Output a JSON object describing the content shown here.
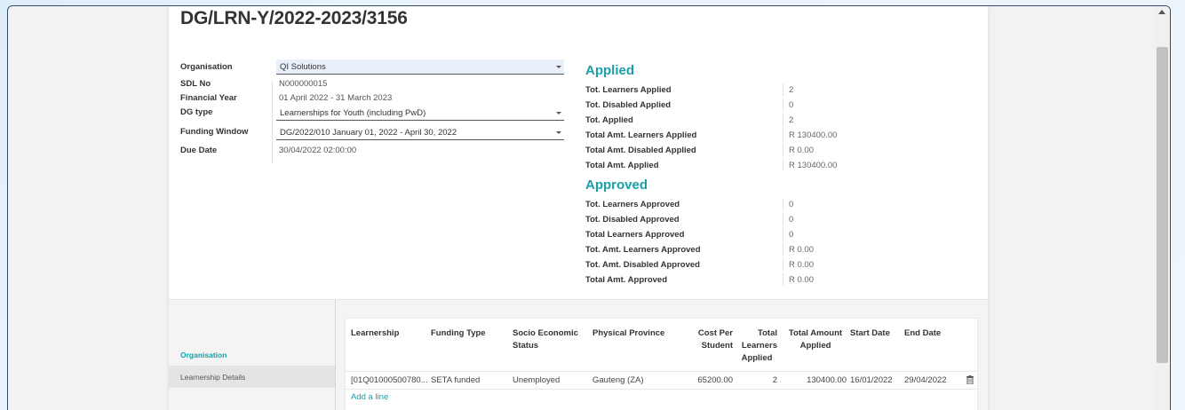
{
  "document": {
    "title": "DG/LRN-Y/2022-2023/3156"
  },
  "form": {
    "organisation": {
      "label": "Organisation",
      "value": "QI Solutions"
    },
    "sdl_no": {
      "label": "SDL No",
      "value": "N000000015"
    },
    "financial_year": {
      "label": "Financial Year",
      "value": "01 April 2022 - 31 March 2023"
    },
    "dg_type": {
      "label": "DG type",
      "value": "Learnerships for Youth (including PwD)"
    },
    "funding_window": {
      "label": "Funding Window",
      "value": "DG/2022/010 January 01, 2022 - April 30, 2022"
    },
    "due_date": {
      "label": "Due Date",
      "value": "30/04/2022 02:00:00"
    }
  },
  "applied": {
    "heading": "Applied",
    "rows": [
      {
        "label": "Tot. Learners Applied",
        "value": "2"
      },
      {
        "label": "Tot. Disabled Applied",
        "value": "0"
      },
      {
        "label": "Tot. Applied",
        "value": "2"
      },
      {
        "label": "Total Amt. Learners Applied",
        "value": "R 130400.00"
      },
      {
        "label": "Total Amt. Disabled Applied",
        "value": "R 0.00"
      },
      {
        "label": "Total Amt. Applied",
        "value": "R 130400.00"
      }
    ]
  },
  "approved": {
    "heading": "Approved",
    "rows": [
      {
        "label": "Tot. Learners Approved",
        "value": "0"
      },
      {
        "label": "Tot. Disabled Approved",
        "value": "0"
      },
      {
        "label": "Total Learners Approved",
        "value": "0"
      },
      {
        "label": "Tot. Amt. Learners Approved",
        "value": "R 0.00"
      },
      {
        "label": "Tot. Amt. Disabled Approved",
        "value": "R 0.00"
      },
      {
        "label": "Total Amt. Approved",
        "value": "R 0.00"
      }
    ]
  },
  "tabs": [
    {
      "label": "Organisation"
    },
    {
      "label": "Learnership Details"
    }
  ],
  "table": {
    "columns": {
      "learnership": "Learnership",
      "funding_type": "Funding Type",
      "socio_line1": "Socio Economic",
      "socio_line2": "Status",
      "province": "Physical Province",
      "cost_line1": "Cost Per",
      "cost_line2": "Student",
      "total_line1": "Total",
      "total_line2": "Learners",
      "total_line3": "Applied",
      "amount_line1": "Total Amount",
      "amount_line2": "Applied",
      "start_date": "Start Date",
      "end_date": "End Date"
    },
    "rows": [
      {
        "learnership": "[01Q01000500780...",
        "funding_type": "SETA funded",
        "socio": "Unemployed",
        "province": "Gauteng (ZA)",
        "cost": "65200.00",
        "learners": "2",
        "amount": "130400.00",
        "start_date": "16/01/2022",
        "end_date": "29/04/2022"
      }
    ],
    "add_line": "Add a line"
  },
  "colors": {
    "accent": "#17a0a6",
    "window_border": "#3a4a6a"
  },
  "icons": {
    "row_delete": "trash-icon",
    "dropdown": "caret-down-icon",
    "scroll": "scroll-up-arrow-icon"
  }
}
